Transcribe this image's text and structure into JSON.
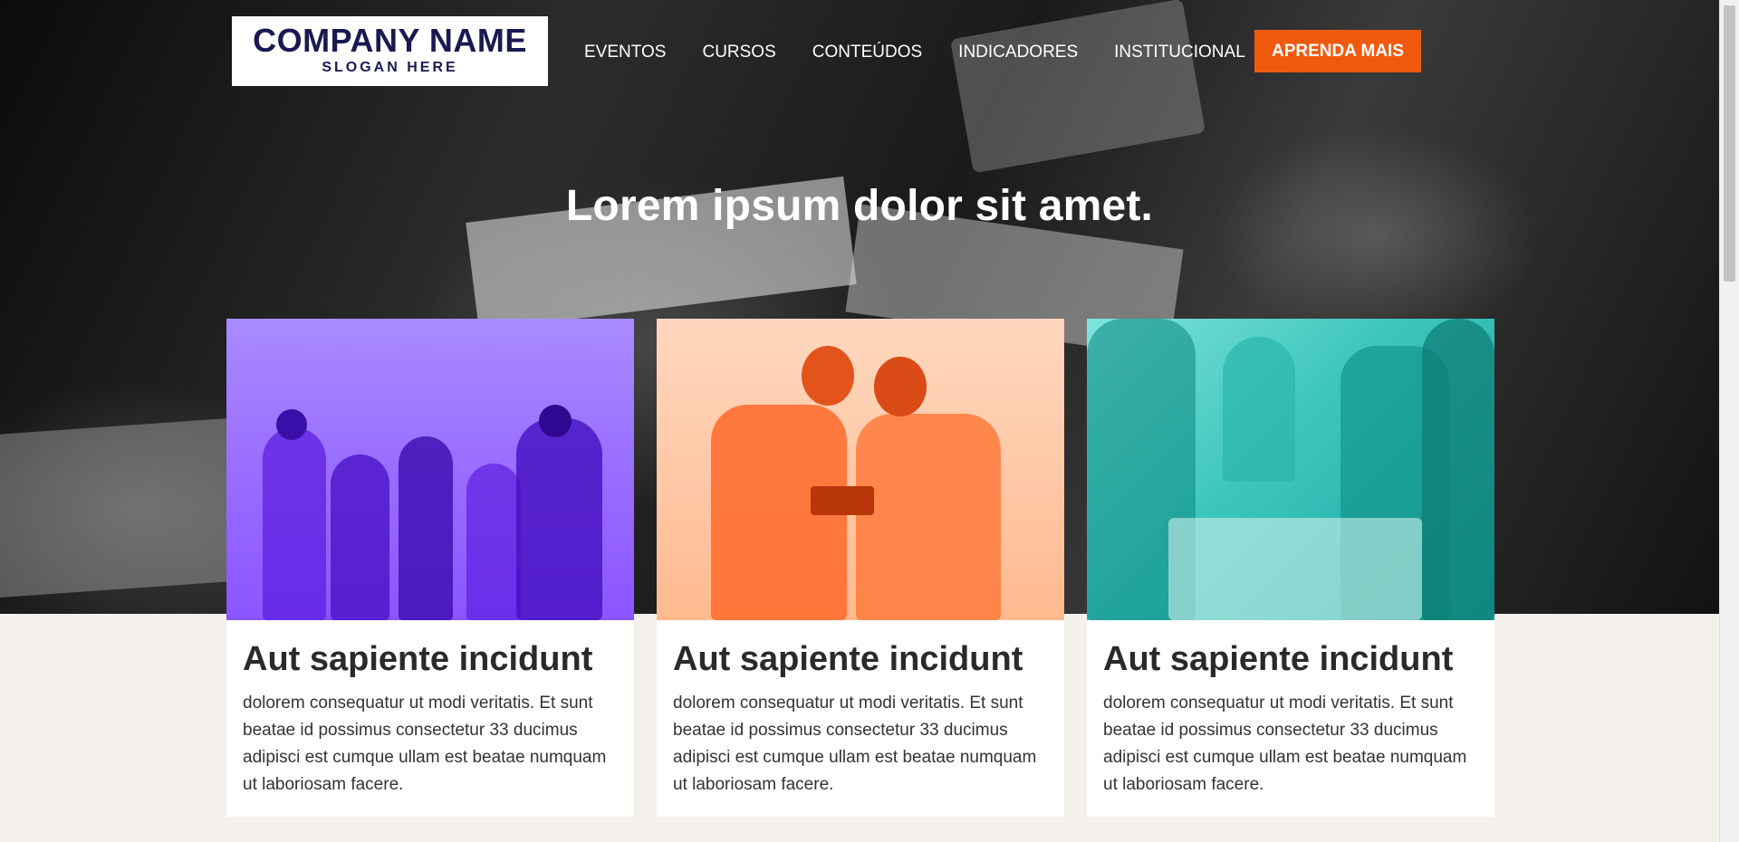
{
  "header": {
    "logo": {
      "name": "COMPANY NAME",
      "slogan": "SLOGAN HERE"
    },
    "menu": [
      {
        "label": "EVENTOS"
      },
      {
        "label": "CURSOS"
      },
      {
        "label": "CONTEÚDOS"
      },
      {
        "label": "INDICADORES"
      },
      {
        "label": "INSTITUCIONAL"
      }
    ],
    "cta_label": "APRENDA MAIS"
  },
  "hero": {
    "title": "Lorem ipsum dolor sit amet."
  },
  "cards": [
    {
      "title": "Aut sapiente incidunt",
      "text": "dolorem consequatur ut modi veritatis. Et sunt beatae id possimus consectetur 33 ducimus adipisci est cumque ullam est beatae numquam ut laboriosam facere.",
      "tint": "#8a55ff"
    },
    {
      "title": "Aut sapiente incidunt",
      "text": "dolorem consequatur ut modi veritatis. Et sunt beatae id possimus consectetur 33 ducimus adipisci est cumque ullam est beatae numquam ut laboriosam facere.",
      "tint": "#ff6a2a"
    },
    {
      "title": "Aut sapiente incidunt",
      "text": "dolorem consequatur ut modi veritatis. Et sunt beatae id possimus consectetur 33 ducimus adipisci est cumque ullam est beatae numquam ut laboriosam facere.",
      "tint": "#16a79f"
    }
  ],
  "colors": {
    "accent": "#f05a0e",
    "logo_text": "#1a1a52",
    "page_bottom": "#f4f1ec"
  }
}
